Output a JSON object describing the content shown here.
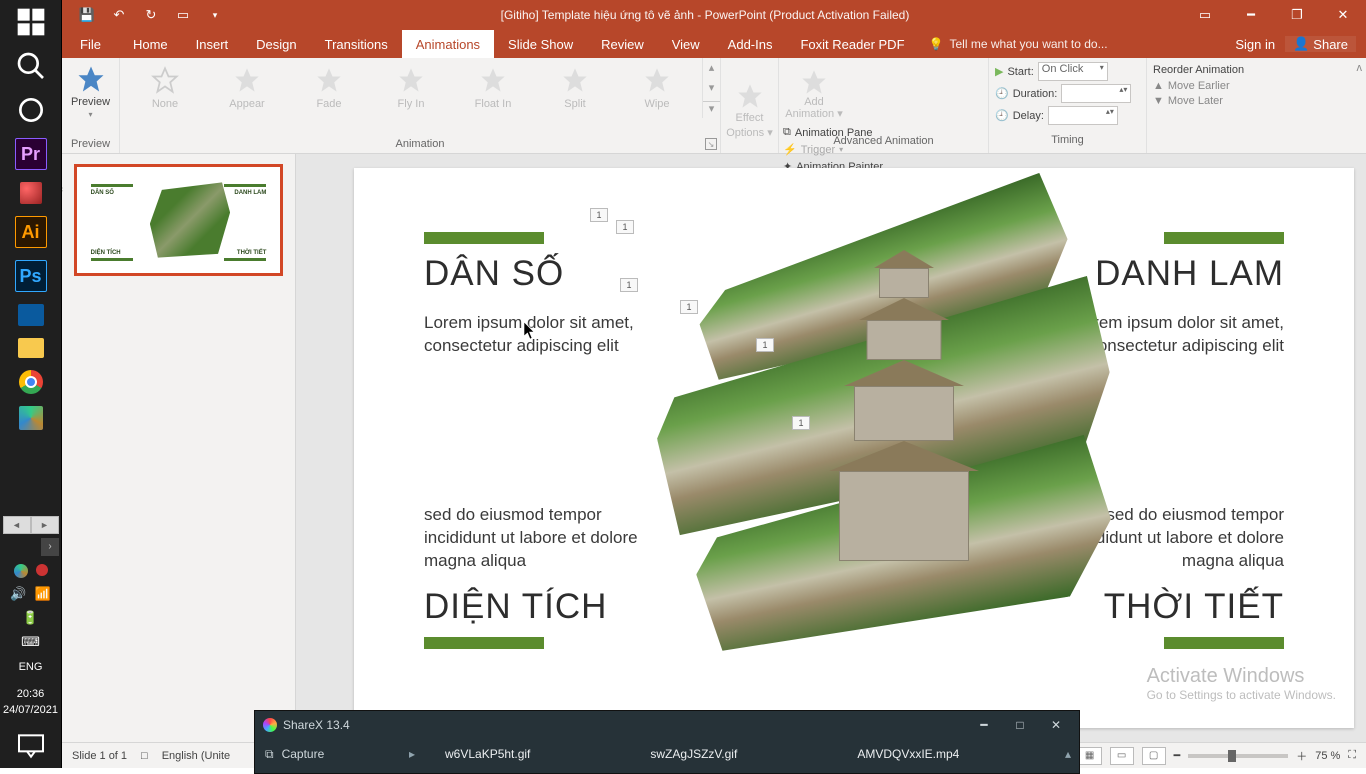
{
  "titlebar": {
    "title": "[Gitiho] Template hiệu ứng tô vẽ ảnh - PowerPoint (Product Activation Failed)"
  },
  "tabs": {
    "file": "File",
    "list": [
      "Home",
      "Insert",
      "Design",
      "Transitions",
      "Animations",
      "Slide Show",
      "Review",
      "View",
      "Add-Ins",
      "Foxit Reader PDF"
    ],
    "active": "Animations",
    "tellme": "Tell me what you want to do...",
    "signin": "Sign in",
    "share": "Share"
  },
  "ribbon": {
    "preview": {
      "label": "Preview",
      "btn": "Preview"
    },
    "animation": {
      "label": "Animation",
      "items": [
        "None",
        "Appear",
        "Fade",
        "Fly In",
        "Float In",
        "Split",
        "Wipe"
      ],
      "effect_options": "Effect\nOptions"
    },
    "advanced": {
      "label": "Advanced Animation",
      "add": "Add\nAnimation",
      "pane": "Animation Pane",
      "trigger": "Trigger",
      "painter": "Animation Painter"
    },
    "timing": {
      "label": "Timing",
      "start": "Start:",
      "start_val": "On Click",
      "duration": "Duration:",
      "delay": "Delay:"
    },
    "reorder": {
      "header": "Reorder Animation",
      "earlier": "Move Earlier",
      "later": "Move Later"
    }
  },
  "slide": {
    "left_top_title": "DÂN SỐ",
    "left_top_body": "Lorem ipsum dolor sit amet, consectetur adipiscing elit",
    "left_bot_body": "sed do eiusmod tempor incididunt ut labore et dolore magna aliqua",
    "left_bot_title": "DIỆN TÍCH",
    "right_top_title": "DANH LAM",
    "right_top_body": "Lorem ipsum dolor sit amet, consectetur adipiscing elit",
    "right_bot_body": "sed do eiusmod tempor incididunt ut labore et dolore magna aliqua",
    "right_bot_title": "THỜI TIẾT",
    "anim_tag": "1"
  },
  "status": {
    "slide": "Slide 1 of 1",
    "lang": "English (Unite",
    "zoom": "75 %"
  },
  "watermark": {
    "line1": "Activate Windows",
    "line2": "Go to Settings to activate Windows."
  },
  "sharex": {
    "title": "ShareX 13.4",
    "capture": "Capture",
    "files": [
      "w6VLaKP5ht.gif",
      "swZAgJSZzV.gif",
      "AMVDQVxxIE.mp4"
    ]
  },
  "taskbar": {
    "lang": "ENG",
    "time": "20:36",
    "date": "24/07/2021"
  },
  "thumb": {
    "t1": "DÂN SỐ",
    "t2": "DANH LAM",
    "t3": "DIỆN TÍCH",
    "t4": "THỜI TIẾT"
  }
}
